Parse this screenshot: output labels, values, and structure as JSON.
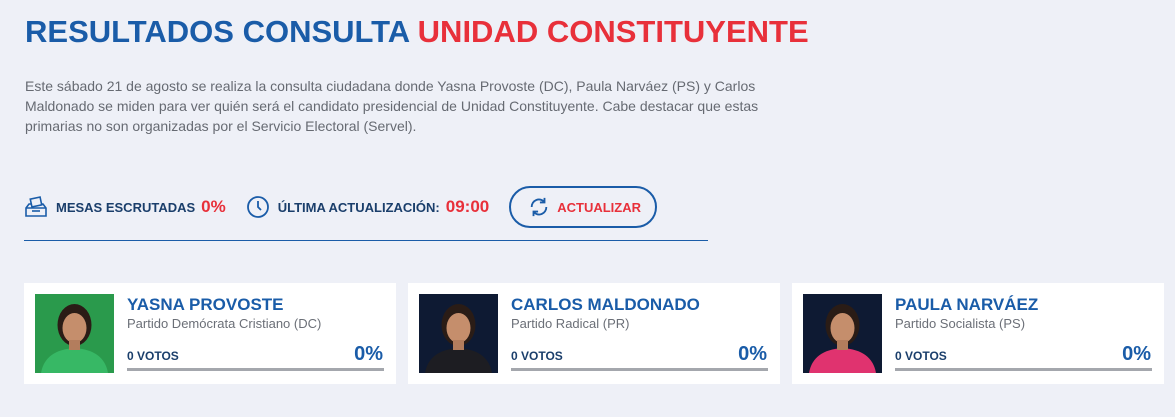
{
  "header": {
    "title_part1": "RESULTADOS CONSULTA",
    "title_part2": "UNIDAD CONSTITUYENTE",
    "intro": "Este sábado 21 de agosto se realiza la consulta ciudadana donde Yasna Provoste (DC), Paula Narváez (PS) y Carlos Maldonado se miden para ver quién será el candidato presidencial de Unidad Constituyente. Cabe destacar que estas primarias no son organizadas por el Servicio Electoral (Servel)."
  },
  "status": {
    "tables_label": "MESAS ESCRUTADAS",
    "tables_value": "0%",
    "update_label": "ÚLTIMA ACTUALIZACIÓN:",
    "update_value": "09:00",
    "refresh_label": "ACTUALIZAR"
  },
  "candidates": [
    {
      "name": "YASNA PROVOSTE",
      "party": "Partido Demócrata Cristiano (DC)",
      "votes": "0 VOTOS",
      "percent": "0%",
      "share": 0,
      "photo_bg": "#2a9a4c",
      "clothing": "#37b865"
    },
    {
      "name": "CARLOS MALDONADO",
      "party": "Partido Radical (PR)",
      "votes": "0 VOTOS",
      "percent": "0%",
      "share": 0,
      "photo_bg": "#0e1a33",
      "clothing": "#1d1d22"
    },
    {
      "name": "PAULA NARVÁEZ",
      "party": "Partido Socialista (PS)",
      "votes": "0 VOTOS",
      "percent": "0%",
      "share": 0,
      "photo_bg": "#0e1a33",
      "clothing": "#e0336f"
    }
  ],
  "colors": {
    "brand_blue": "#1a5ca8",
    "accent_red": "#e8303a",
    "background": "#eef0f7"
  },
  "icons": {
    "tables": "ballot-box-icon",
    "update": "clock-icon",
    "refresh": "refresh-icon"
  }
}
